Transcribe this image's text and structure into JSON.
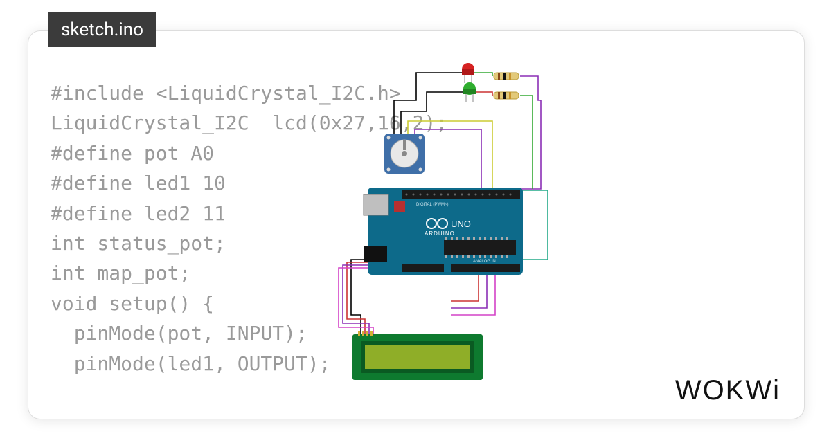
{
  "tab": {
    "filename": "sketch.ino"
  },
  "code": {
    "lines": [
      "#include <LiquidCrystal_I2C.h>",
      "LiquidCrystal_I2C  lcd(0x27,16,2);",
      "#define pot A0",
      "#define led1 10",
      "#define led2 11",
      "int status_pot;",
      "int map_pot;",
      "void setup() {",
      "  pinMode(pot, INPUT);",
      "  pinMode(led1, OUTPUT);"
    ]
  },
  "branding": {
    "name": "WOKWi"
  },
  "circuit": {
    "board": "UNO",
    "board_brand": "ARDUINO",
    "components": [
      {
        "type": "led",
        "color": "red",
        "pin": "10"
      },
      {
        "type": "led",
        "color": "green",
        "pin": "11"
      },
      {
        "type": "resistor",
        "count": 2
      },
      {
        "type": "potentiometer",
        "pin": "A0"
      },
      {
        "type": "lcd_i2c",
        "address": "0x27",
        "cols": 16,
        "rows": 2
      }
    ],
    "wire_colors": [
      "red",
      "black",
      "green",
      "yellow",
      "purple",
      "magenta"
    ]
  }
}
